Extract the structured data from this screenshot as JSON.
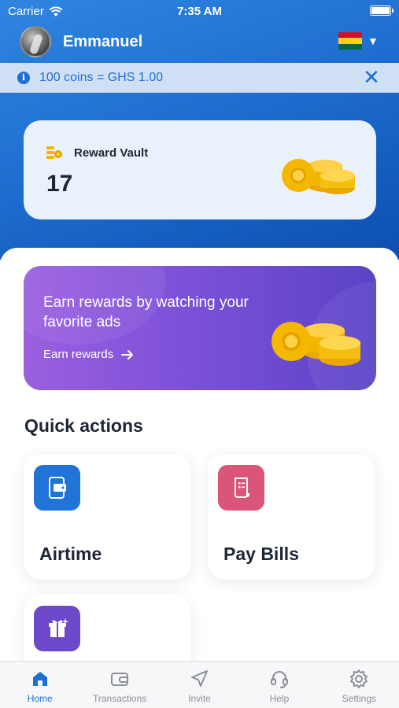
{
  "status_bar": {
    "carrier": "Carrier",
    "time": "7:35 AM"
  },
  "header": {
    "username": "Emmanuel",
    "country_flag": "ghana-flag-icon"
  },
  "banner": {
    "text": "100 coins = GHS 1.00"
  },
  "vault": {
    "title": "Reward Vault",
    "value": "17"
  },
  "promo": {
    "title": "Earn rewards by watching your favorite ads",
    "link_label": "Earn rewards"
  },
  "quick_actions": {
    "title": "Quick actions",
    "items": [
      {
        "label": "Airtime",
        "icon": "wallet-phone-icon",
        "color": "#1f74d6"
      },
      {
        "label": "Pay Bills",
        "icon": "receipt-icon",
        "color": "#d9567a"
      },
      {
        "label": "",
        "icon": "gift-icon",
        "color": "#6c49c9"
      }
    ]
  },
  "tabs": [
    {
      "label": "Home",
      "icon": "home-icon",
      "active": true
    },
    {
      "label": "Transactions",
      "icon": "wallet-icon",
      "active": false
    },
    {
      "label": "Invite",
      "icon": "send-icon",
      "active": false
    },
    {
      "label": "Help",
      "icon": "headset-icon",
      "active": false
    },
    {
      "label": "Settings",
      "icon": "gear-icon",
      "active": false
    }
  ],
  "colors": {
    "primary": "#1f6fd0",
    "promo": "#7d51d8",
    "vault_bg": "#e9f2fb"
  }
}
